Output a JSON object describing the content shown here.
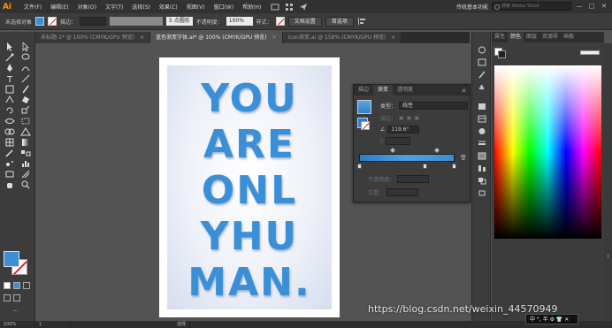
{
  "app": {
    "logo": "Ai",
    "menus": [
      "文件(F)",
      "编辑(E)",
      "对象(O)",
      "文字(T)",
      "选择(S)",
      "效果(C)",
      "视图(V)",
      "窗口(W)",
      "帮助(H)"
    ],
    "workspace": "传统基本功能",
    "search_placeholder": "搜索 Adobe Stock",
    "win_min": "—",
    "win_max": "□",
    "win_close": "✕"
  },
  "control_bar": {
    "selection_label": "未选择对象",
    "stroke_label": "描边：",
    "stroke_value": "",
    "brush_label": "5 点圆形",
    "opacity_label": "不透明度：",
    "opacity_value": "100%",
    "style_label": "样式：",
    "doc_setup_button": "文档设置",
    "prefs_button": "首选项"
  },
  "tabs": [
    {
      "label": "未标题-1* @ 100% (CMYK/GPU 预览)",
      "active": false
    },
    {
      "label": "蓝色渐变字体.ai* @ 100% (CMYK/GPU 预览)",
      "active": true
    },
    {
      "label": "icon渐变.ai @ 158% (CMYK/GPU 预览)",
      "active": false
    }
  ],
  "poster": {
    "lines": [
      "YOU",
      "ARE",
      "ONL",
      "YHU",
      "MAN."
    ]
  },
  "gradient_panel": {
    "tabs": [
      "描边",
      "渐变",
      "透明度"
    ],
    "active_tab": "渐变",
    "menu_glyph": "≡",
    "type_label": "类型：",
    "type_value": "线性",
    "stroke_label": "描边：",
    "angle_value": "119.6°",
    "opacity_label": "不透明度：",
    "position_label": "位置："
  },
  "color_panel": {
    "tabs": [
      "属性",
      "颜色",
      "图层",
      "资源导",
      "画板"
    ],
    "active_tab": "颜色"
  },
  "status_bar": {
    "zoom": "100%",
    "page": "1",
    "tool": "选择"
  },
  "watermark": "https://blog.csdn.net/weixin_44570949",
  "ime_text": "中 °, 半 ⚙ 👕 ✕",
  "colors": {
    "accent": "#3b8fd4",
    "ai_logo": "#ff9a00",
    "chrome_dark": "#323232",
    "panel": "#3c3c3c",
    "canvas": "#535353"
  }
}
